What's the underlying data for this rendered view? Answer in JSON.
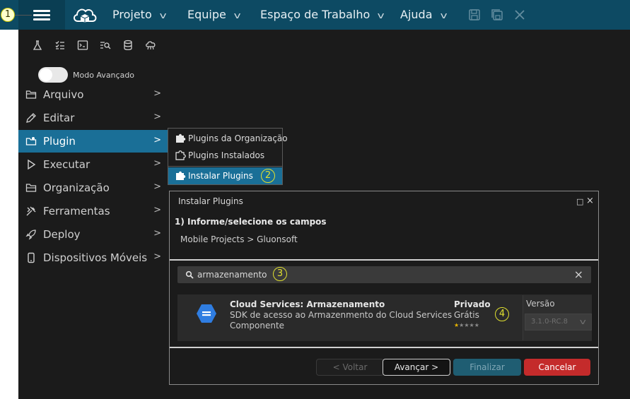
{
  "topbar": {
    "menus": [
      {
        "label": "Projeto"
      },
      {
        "label": "Equipe"
      },
      {
        "label": "Espaço de Trabalho"
      },
      {
        "label": "Ajuda"
      }
    ],
    "icons": [
      "menu-icon",
      "cloud-logo-icon",
      "save-icon",
      "save-all-icon",
      "close-icon"
    ]
  },
  "callouts": [
    "1",
    "2",
    "3",
    "4"
  ],
  "sidebar": {
    "tool_icons": [
      "flask-icon",
      "checklist-icon",
      "terminal-icon",
      "search-list-icon",
      "database-icon",
      "cloud-network-icon"
    ],
    "advanced_mode_label": "Modo Avançado",
    "items": [
      {
        "label": "Arquivo",
        "icon": "folder-icon"
      },
      {
        "label": "Editar",
        "icon": "pencil-icon"
      },
      {
        "label": "Plugin",
        "icon": "plugin-icon"
      },
      {
        "label": "Executar",
        "icon": "play-icon"
      },
      {
        "label": "Organização",
        "icon": "folder-open-icon"
      },
      {
        "label": "Ferramentas",
        "icon": "tools-icon"
      },
      {
        "label": "Deploy",
        "icon": "rocket-icon"
      },
      {
        "label": "Dispositivos Móveis",
        "icon": "mobile-icon"
      }
    ]
  },
  "plugin_submenu": {
    "items": [
      {
        "label": "Plugins da Organização"
      },
      {
        "label": "Plugins Instalados"
      },
      {
        "label": "Instalar Plugins"
      }
    ]
  },
  "dialog": {
    "title": "Instalar Plugins",
    "step": "1) Informe/selecione os campos",
    "path": "Mobile Projects > Gluonsoft",
    "search_value": "armazenamento",
    "plugin": {
      "name": "Cloud Services: Armazenamento",
      "description": "SDK de acesso ao Armazenmento do Cloud Services",
      "type": "Componente",
      "visibility": "Privado",
      "price": "Grátis",
      "rating": 1,
      "rating_max": 5,
      "version_label": "Versão",
      "version_value": "3.1.0-RC.8"
    },
    "buttons": {
      "back": "< Voltar",
      "next": "Avançar >",
      "finish": "Finalizar",
      "cancel": "Cancelar"
    }
  }
}
